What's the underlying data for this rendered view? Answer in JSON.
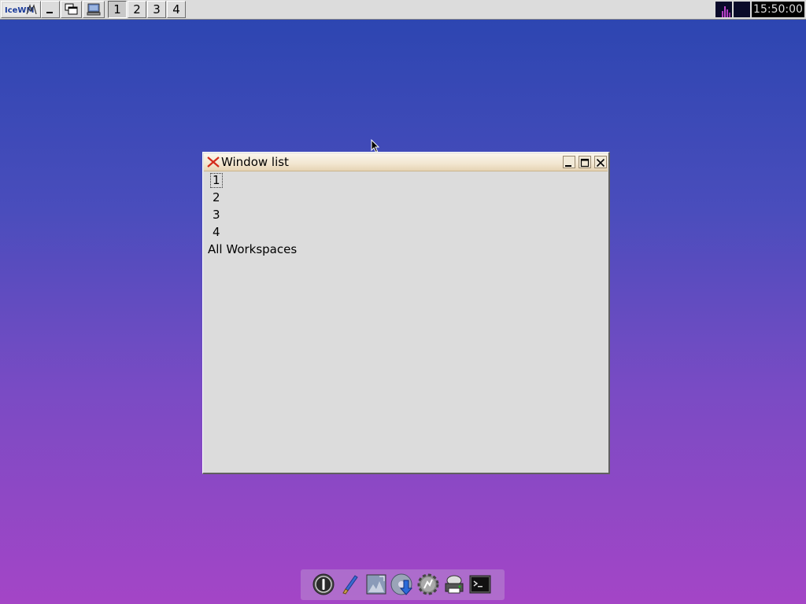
{
  "taskbar": {
    "start_label": "IceWM",
    "workspaces": [
      "1",
      "2",
      "3",
      "4"
    ],
    "active_workspace": "1",
    "clock": "15:50:00",
    "icons": {
      "minimize_all": "minimize-all-icon",
      "window_list": "window-list-icon",
      "show_desktop": "show-desktop-icon",
      "cpu": "cpu-monitor-icon",
      "network": "network-monitor-icon"
    }
  },
  "window": {
    "title": "Window list",
    "items": [
      {
        "label": "1",
        "selected": true
      },
      {
        "label": "2",
        "selected": false
      },
      {
        "label": "3",
        "selected": false
      },
      {
        "label": "4",
        "selected": false
      }
    ],
    "all_label": "All Workspaces"
  },
  "dock": {
    "icons": [
      "power-icon",
      "paintbrush-icon",
      "image-editor-icon",
      "download-icon",
      "gear-icon",
      "printer-icon",
      "terminal-icon"
    ]
  },
  "colors": {
    "desktop_top": "#2a45b0",
    "desktop_bottom": "#a445c6",
    "titlebar": "#f2e6d0",
    "panel": "#dcdcdc"
  }
}
